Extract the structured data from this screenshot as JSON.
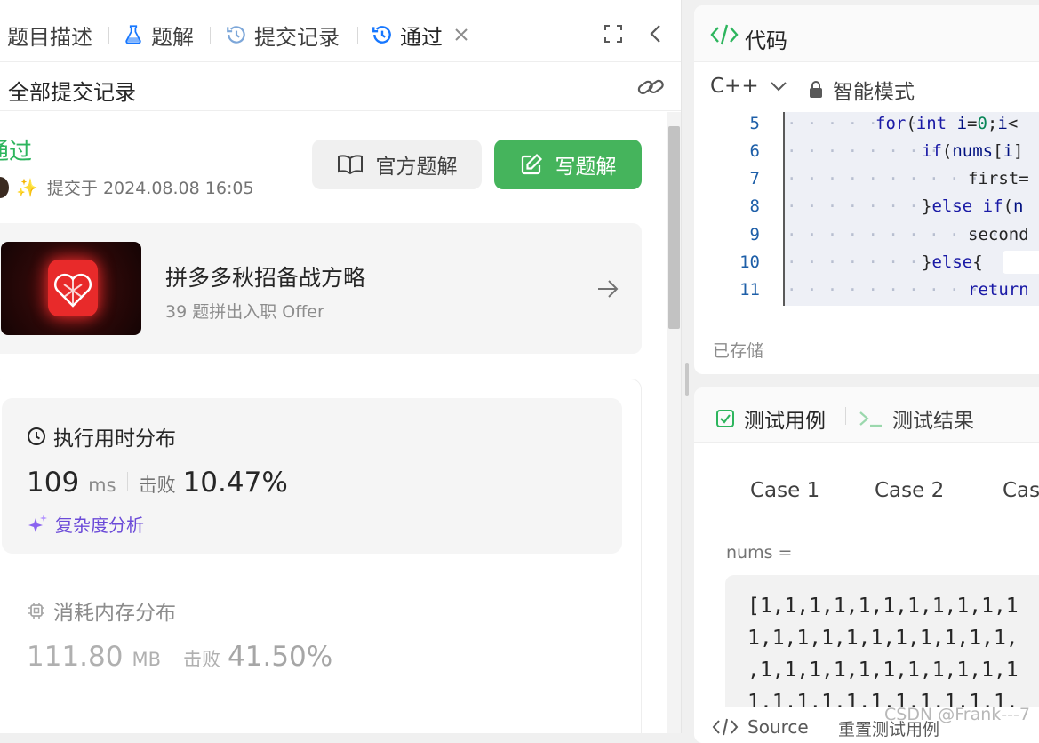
{
  "tabs": [
    {
      "label": "题目描述",
      "icon": "document-icon"
    },
    {
      "label": "题解",
      "icon": "flask-icon"
    },
    {
      "label": "提交记录",
      "icon": "history-icon"
    },
    {
      "label": "通过",
      "icon": "history-icon",
      "active": true
    }
  ],
  "submission": {
    "header": "全部提交记录",
    "status": "通过",
    "submitted_at": "提交于 2024.08.08 16:05",
    "official_solution_label": "官方题解",
    "write_solution_label": "写题解"
  },
  "promo": {
    "title": "拼多多秋招备战方略",
    "subtitle": "39 题拼出入职 Offer"
  },
  "runtime": {
    "title": "执行用时分布",
    "value": "109",
    "unit": "ms",
    "beat_label": "击败",
    "beat_pct": "10.47%",
    "complexity_label": "复杂度分析"
  },
  "memory": {
    "title": "消耗内存分布",
    "value": "111.80",
    "unit": "MB",
    "beat_label": "击败",
    "beat_pct": "41.50%"
  },
  "code_panel": {
    "title": "代码",
    "language": "C++",
    "mode": "智能模式",
    "saved": "已存储",
    "lines": [
      {
        "n": "5",
        "indent": 4
      },
      {
        "n": "6",
        "indent": 5
      },
      {
        "n": "7",
        "indent": 6
      },
      {
        "n": "8",
        "indent": 5
      },
      {
        "n": "9",
        "indent": 6
      },
      {
        "n": "10",
        "indent": 5
      },
      {
        "n": "11",
        "indent": 6
      }
    ]
  },
  "test_panel": {
    "tab_cases": "测试用例",
    "tab_results": "测试结果",
    "cases": [
      "Case 1",
      "Case 2",
      "Cas"
    ],
    "input_label": "nums =",
    "input_lines": [
      "[1,1,1,1,1,1,1,1,1,1,1",
      "1,1,1,1,1,1,1,1,1,1,1,",
      ",1,1,1,1,1,1,1,1,1,1,1",
      "1,1,1,1,1,1,1,1,1,1,1,"
    ],
    "source_label": "Source",
    "reset_label": "重置测试用例"
  },
  "watermark": "CSDN @Frank---7",
  "colors": {
    "pass_green": "#2db55d",
    "write_button": "#45b45c",
    "active_tab_icon": "#1677ff",
    "complexity_purple": "#6b4ad8"
  }
}
